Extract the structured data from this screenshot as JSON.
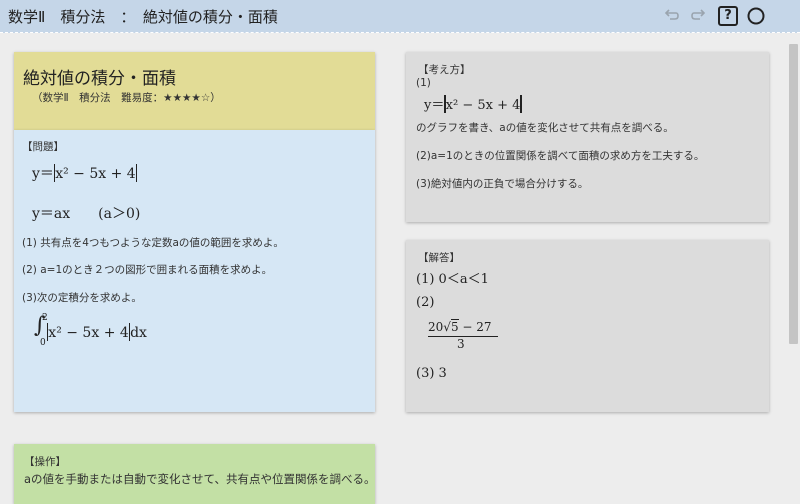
{
  "header": {
    "title": "数学Ⅱ　積分法　：　絶対値の積分・面積",
    "icons": [
      "undo-icon",
      "redo-icon",
      "help-icon",
      "circle-icon"
    ],
    "help_glyph": "?"
  },
  "title_card": {
    "title": "絶対値の積分・面積",
    "subtitle": "（数学Ⅱ　積分法　難易度：★★★★☆）"
  },
  "problem": {
    "heading": "【問題】",
    "eq1_lhs": "y＝",
    "eq1_body": "x² − 5x + 4",
    "eq2": "y＝ax　　(a＞0)",
    "q1": "(1) 共有点を4つもつような定数aの値の範囲を求めよ。",
    "q2": "(2) a=1のとき２つの図形で囲まれる面積を求めよ。",
    "q3": "(3)次の定積分を求めよ。",
    "integral_upper": "2",
    "integral_lower": "0",
    "integral_body": "x² − 5x + 4",
    "integral_dx": "dx"
  },
  "approach": {
    "heading": "【考え方】",
    "n1": "(1)",
    "eq_lhs": "y＝",
    "eq_body": "x² − 5x + 4",
    "t1": "のグラフを書き、aの値を変化させて共有点を調べる。",
    "t2": "(2)a=1のときの位置関係を調べて面積の求め方を工夫する。",
    "t3": "(3)絶対値内の正負で場合分けする。"
  },
  "answer": {
    "heading": "【解答】",
    "a1": "(1) 0＜a＜1",
    "a2": "(2)",
    "a2_num_pre": "20",
    "a2_sqrt": "5",
    "a2_num_post": " − 27",
    "a2_den": "3",
    "a3": "(3) 3"
  },
  "operation": {
    "heading": "【操作】",
    "text": "aの値を手動または自動で変化させて、共有点や位置関係を調べる。"
  },
  "colors": {
    "topbar": "#c5d6e8",
    "background": "#ededed",
    "title_card": "#e2dc96",
    "problem_card": "#d6e7f5",
    "gray_card": "#dcdcdc",
    "operation_card": "#c3e0a5"
  }
}
